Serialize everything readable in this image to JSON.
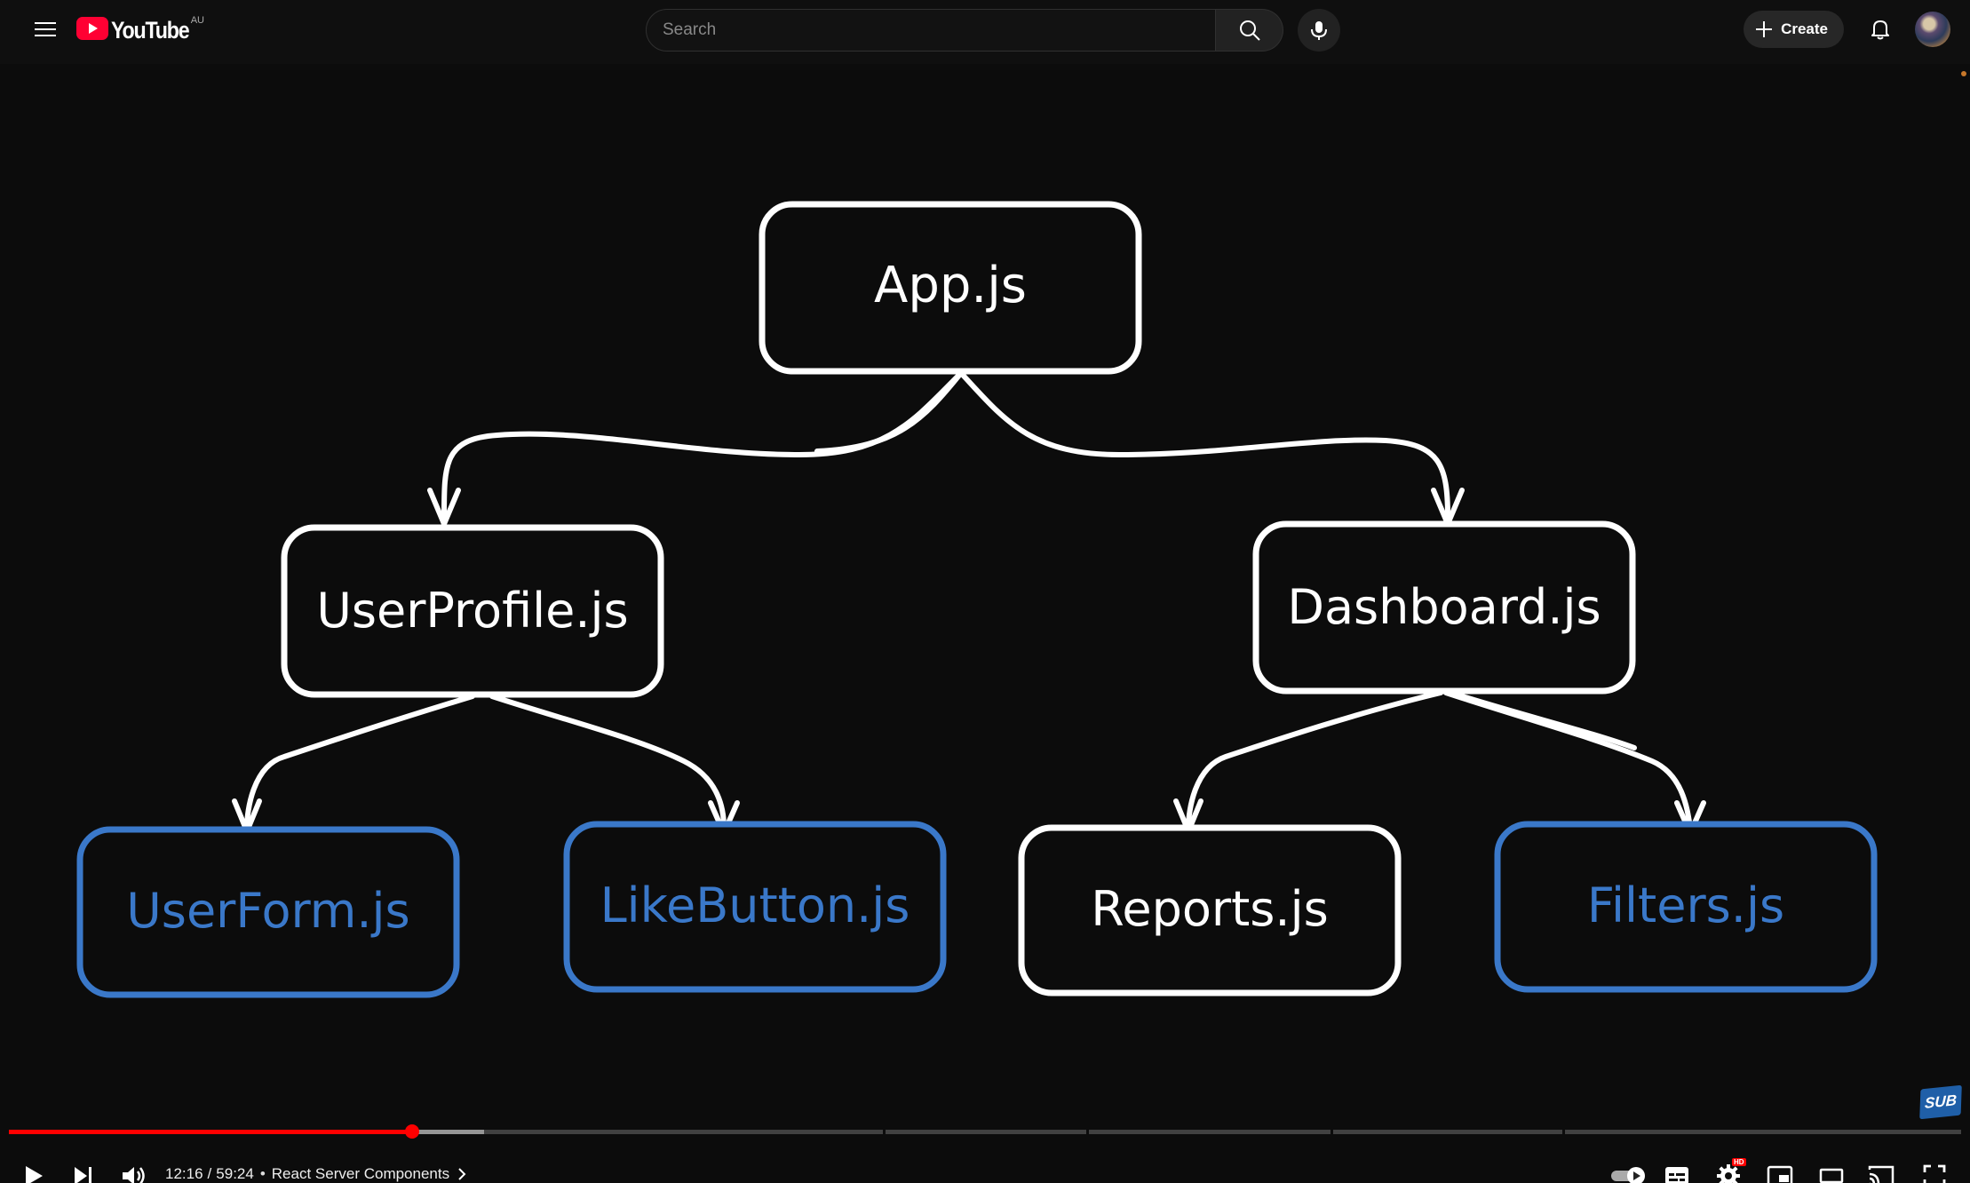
{
  "masthead": {
    "logo_text": "YouTube",
    "country": "AU",
    "search_placeholder": "Search",
    "create_label": "Create"
  },
  "diagram": {
    "nodes": [
      {
        "id": "app",
        "label": "App.js",
        "color": "#ffffff"
      },
      {
        "id": "userprofile",
        "label": "UserProfile.js",
        "color": "#ffffff"
      },
      {
        "id": "dashboard",
        "label": "Dashboard.js",
        "color": "#ffffff"
      },
      {
        "id": "userform",
        "label": "UserForm.js",
        "color": "#3a78c9"
      },
      {
        "id": "likebutton",
        "label": "LikeButton.js",
        "color": "#3a78c9"
      },
      {
        "id": "reports",
        "label": "Reports.js",
        "color": "#ffffff"
      },
      {
        "id": "filters",
        "label": "Filters.js",
        "color": "#3a78c9"
      }
    ]
  },
  "player": {
    "current_time": "12:16",
    "duration": "59:24",
    "separator": "/",
    "bullet": "•",
    "chapter_title": "React Server Components",
    "progress_fraction": 0.2065,
    "buffered_fraction": 0.2435,
    "sub_badge": "SUB",
    "hd_badge": "HD",
    "accent_color": "#ff0000"
  }
}
